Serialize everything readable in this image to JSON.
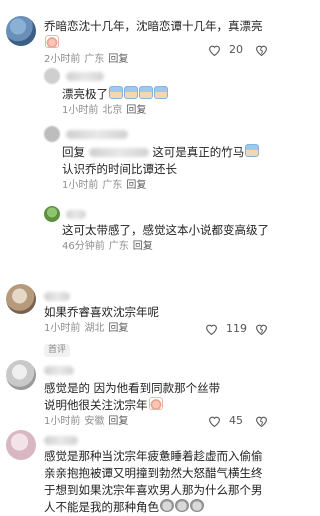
{
  "comments": [
    {
      "text": "乔暗恋沈十几年，沈暗恋谭十几年，真漂亮",
      "time": "2小时前",
      "location": "广东",
      "reply": "回复",
      "likes": "20"
    },
    {
      "text": "漂亮极了",
      "time": "1小时前",
      "location": "北京",
      "reply": "回复"
    },
    {
      "reply_prefix": "回复",
      "text": "这可是真正的竹马",
      "text2": "认识乔的时间比谭还长",
      "time": "1小时前",
      "location": "广东",
      "reply": "回复"
    },
    {
      "text": "这可太带感了，感觉这本小说都变高级了",
      "time": "46分钟前",
      "location": "广东",
      "reply": "回复"
    },
    {
      "text": "如果乔睿喜欢沈宗年呢",
      "time": "1小时前",
      "location": "湖北",
      "reply": "回复",
      "likes": "119"
    },
    {
      "tag": "首评",
      "text": "感觉是的 因为他看到同款那个丝带 说明他很关注沈宗年",
      "time": "1小时前",
      "location": "安徽",
      "reply": "回复",
      "likes": "45"
    },
    {
      "text": "感觉是那种当沈宗年疲惫睡着趁虚而入偷偷亲亲抱抱被谭又明撞到勃然大怒醋气横生终于想到如果沈宗年喜欢男人那为什么那个男人不能是我的那种角色"
    }
  ]
}
